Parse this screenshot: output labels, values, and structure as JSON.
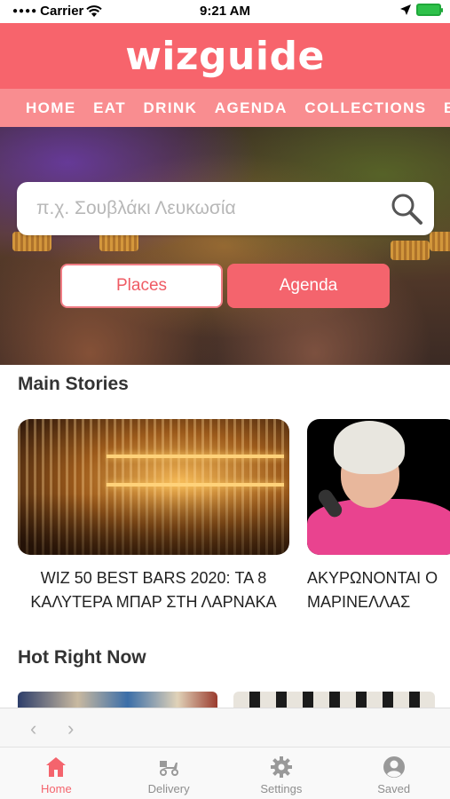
{
  "status_bar": {
    "carrier": "Carrier",
    "time": "9:21 AM"
  },
  "app": {
    "logo": "wizguide"
  },
  "nav": {
    "items": [
      "HOME",
      "EAT",
      "DRINK",
      "AGENDA",
      "COLLECTIONS",
      "BL"
    ]
  },
  "search": {
    "placeholder": "π.χ. Σουβλάκι Λευκωσία"
  },
  "toggle": {
    "places": "Places",
    "agenda": "Agenda",
    "selected": "Agenda"
  },
  "main_stories": {
    "title": "Main Stories",
    "cards": [
      {
        "title": "WIZ 50 BEST BARS 2020: ΤΑ 8\nΚΑΛΥΤΕΡΑ ΜΠΑΡ ΣΤΗ ΛΑΡΝΑΚΑ"
      },
      {
        "title": "ΑΚΥΡΩΝΟΝΤΑΙ Ο\nΜΑΡΙΝΕΛΛΑΣ"
      }
    ]
  },
  "hot_right_now": {
    "title": "Hot Right Now"
  },
  "tab_bar": {
    "items": [
      {
        "label": "Home",
        "icon": "home-icon",
        "active": true
      },
      {
        "label": "Delivery",
        "icon": "delivery-scooter-icon",
        "active": false
      },
      {
        "label": "Settings",
        "icon": "gear-icon",
        "active": false
      },
      {
        "label": "Saved",
        "icon": "user-icon",
        "active": false
      }
    ]
  },
  "colors": {
    "brand": "#f7646c",
    "nav_bg": "#f98d90",
    "active_tab": "#f4646d"
  }
}
